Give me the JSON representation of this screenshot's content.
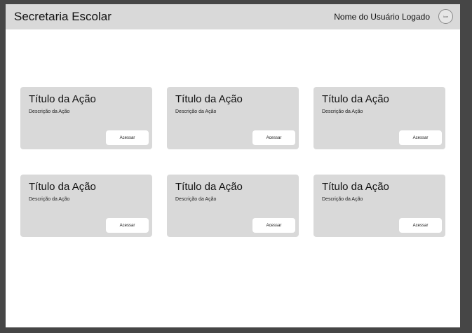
{
  "header": {
    "title": "Secretaria Escolar",
    "user_name": "Nome do Usuário Logado",
    "avatar_label": "Icon"
  },
  "cards": [
    {
      "title": "Título da Ação",
      "description": "Descrição da Ação",
      "button_label": "Acessar"
    },
    {
      "title": "Título da Ação",
      "description": "Descrição da Ação",
      "button_label": "Acessar"
    },
    {
      "title": "Título da Ação",
      "description": "Descrição da Ação",
      "button_label": "Acessar"
    },
    {
      "title": "Título da Ação",
      "description": "Descrição da Ação",
      "button_label": "Acessar"
    },
    {
      "title": "Título da Ação",
      "description": "Descrição da Ação",
      "button_label": "Acessar"
    },
    {
      "title": "Título da Ação",
      "description": "Descrição da Ação",
      "button_label": "Acessar"
    }
  ],
  "colors": {
    "backdrop": "#464646",
    "page_background": "#ffffff",
    "header_background": "#d9d9d9",
    "card_background": "#d9d9d9",
    "button_background": "#ffffff"
  }
}
